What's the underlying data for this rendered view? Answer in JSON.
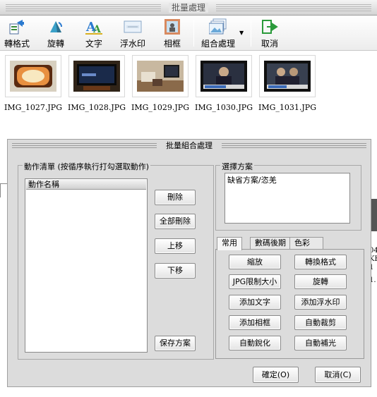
{
  "window": {
    "title": "批量處理"
  },
  "toolbar": {
    "convert_label": "轉格式",
    "rotate_label": "旋轉",
    "text_label": "文字",
    "watermark_label": "浮水印",
    "frame_label": "相框",
    "combo_label": "組合處理",
    "cancel_label": "取消"
  },
  "thumbnails": [
    {
      "name": "IMG_1027.JPG"
    },
    {
      "name": "IMG_1028.JPG"
    },
    {
      "name": "IMG_1029.JPG"
    },
    {
      "name": "IMG_1030.JPG"
    },
    {
      "name": "IMG_1031.JPG"
    }
  ],
  "background": {
    "right_text_1": "04",
    "right_text_2": "KE",
    "right_text_3": "1",
    "right_text_4": "1."
  },
  "dialog": {
    "title": "批量組合處理",
    "action_list": {
      "group_label": "動作清單 (按循序執行打勾選取動作)",
      "column_header": "動作名稱",
      "delete_label": "刪除",
      "delete_all_label": "全部刪除",
      "move_up_label": "上移",
      "move_down_label": "下移",
      "save_scheme_label": "保存方案"
    },
    "scheme": {
      "group_label": "選擇方案",
      "selected": "缺省方案/恣羌"
    },
    "tabs": [
      {
        "label": "常用"
      },
      {
        "label": "數碼後期"
      },
      {
        "label": "色彩"
      }
    ],
    "ops": {
      "resize": "縮放",
      "convert_format": "轉換格式",
      "jpg_limit": "JPG限制大小",
      "rotate": "旋轉",
      "add_text": "添加文字",
      "add_watermark": "添加浮水印",
      "add_frame": "添加相框",
      "auto_crop": "自動裁剪",
      "auto_sharpen": "自動銳化",
      "auto_fill_light": "自動補光"
    },
    "ok_label": "確定(O)",
    "cancel_label": "取消(C)"
  }
}
